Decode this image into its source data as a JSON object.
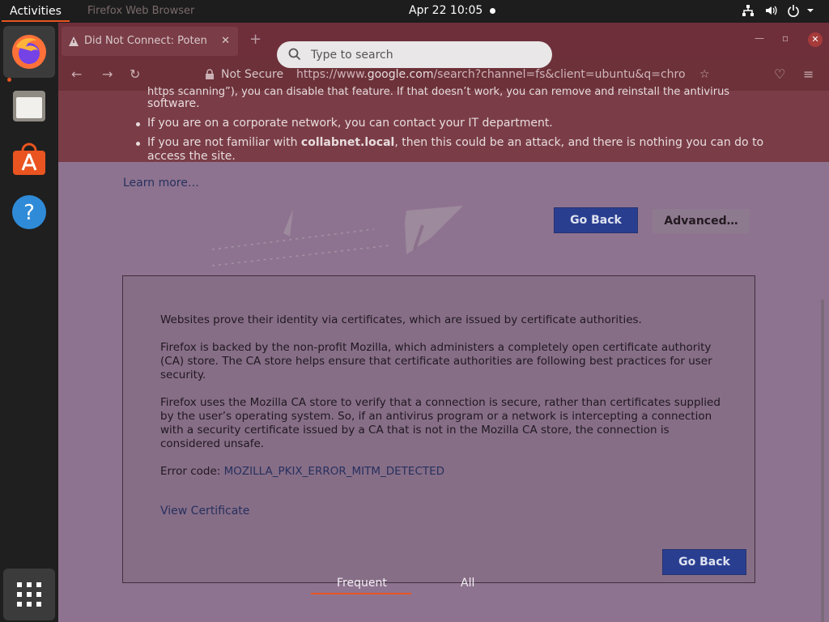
{
  "topbar": {
    "activities": "Activities",
    "app_menu": "Firefox Web Browser",
    "clock": "Apr 22  10:05"
  },
  "dock": {
    "items": [
      "firefox-icon",
      "files-icon",
      "software-store-icon",
      "help-icon"
    ],
    "show_apps": "grid-icon"
  },
  "browser": {
    "tab_title": "Did Not Connect: Poten",
    "url_security": "Not Secure",
    "url_prefix": "https://www.",
    "url_domain": "google.com",
    "url_suffix": "/search?channel=fs&client=ubuntu&q=chro"
  },
  "banner": {
    "partial_top": "https scanning”), you can disable that feature. If that doesn’t work, you can remove and reinstall the antivirus",
    "partial_top2": "software.",
    "bullet1": "If you are on a corporate network, you can contact your IT department.",
    "bullet2_pre": "If you are not familiar with ",
    "bullet2_bold": "collabnet.local",
    "bullet2_post": ", then this could be an attack, and there is nothing you can do to",
    "bullet2_cont": "access the site."
  },
  "page": {
    "learn_more": "Learn more…",
    "go_back": "Go Back",
    "advanced": "Advanced…",
    "adv_p1": "Websites prove their identity via certificates, which are issued by certificate authorities.",
    "adv_p2": "Firefox is backed by the non-profit Mozilla, which administers a completely open certificate authority (CA) store. The CA store helps ensure that certificate authorities are following best practices for user security.",
    "adv_p3": "Firefox uses the Mozilla CA store to verify that a connection is secure, rather than certificates supplied by the user’s operating system. So, if an antivirus program or a network is intercepting a connection with a security certificate issued by a CA that is not in the Mozilla CA store, the connection is considered unsafe.",
    "error_label": "Error code: ",
    "error_code": "MOZILLA_PKIX_ERROR_MITM_DETECTED",
    "view_cert": "View Certificate",
    "go_back_bottom": "Go Back"
  },
  "overview": {
    "search_placeholder": "Type to search",
    "tab_frequent": "Frequent",
    "tab_all": "All"
  },
  "colors": {
    "accent": "#e95420",
    "button_blue": "#2a3e90"
  }
}
